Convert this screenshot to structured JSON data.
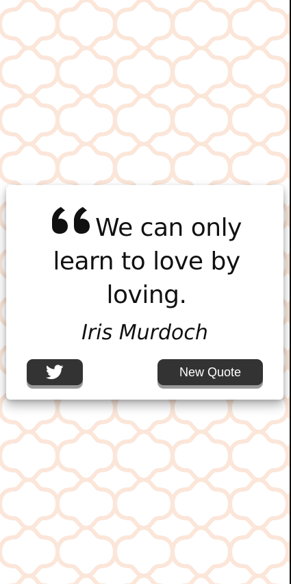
{
  "quote": {
    "text": "We can only learn to love by loving.",
    "author": "Iris Murdoch",
    "icon": "quote-left-icon"
  },
  "buttons": {
    "tweet_icon": "twitter-icon",
    "new_quote_label": "New Quote"
  },
  "colors": {
    "button_bg": "#333333",
    "button_text": "#ffffff",
    "pattern": "#fbe6d9",
    "card_bg": "#ffffff"
  }
}
